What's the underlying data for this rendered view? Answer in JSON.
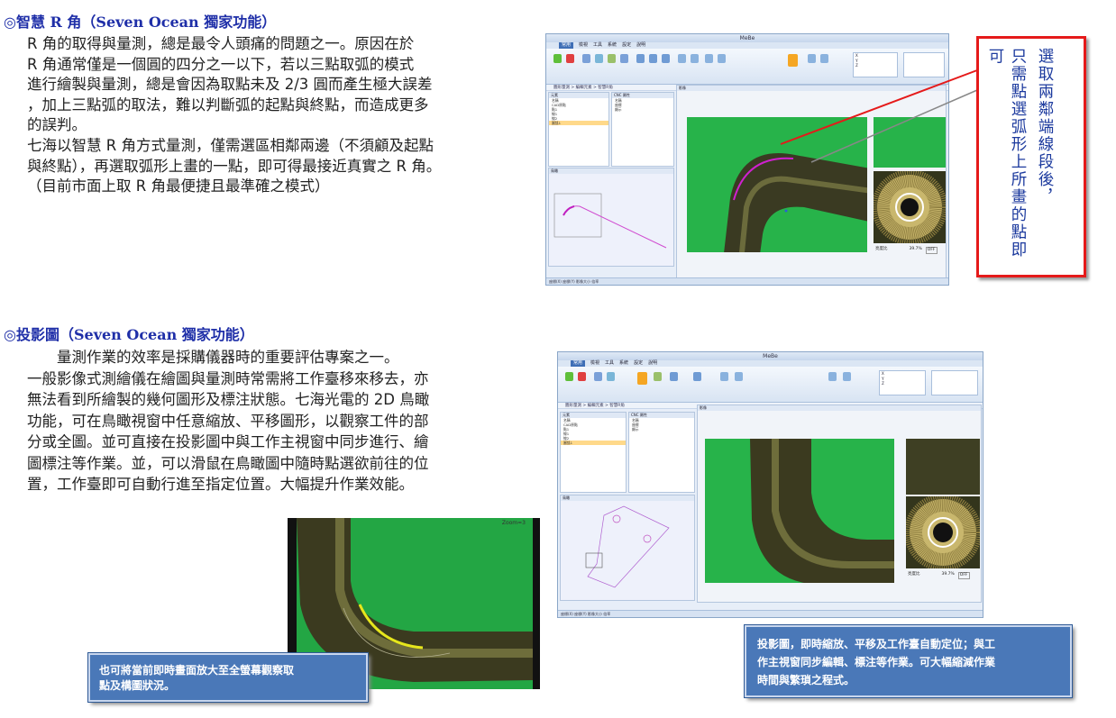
{
  "section1": {
    "heading": "◎智慧 R 角（Seven Ocean 獨家功能）",
    "lines": [
      "R 角的取得與量測，總是最令人頭痛的問題之一。原因在於",
      "R 角通常僅是一個圓的四分之一以下，若以三點取弧的模式",
      "進行繪製與量測，總是會因為取點未及 2/3 圓而產生極大誤差",
      "，加上三點弧的取法，難以判斷弧的起點與終點，而造成更多",
      "的誤判。",
      "七海以智慧 R 角方式量測，僅需選區相鄰兩邊（不須顧及起點",
      "與終點），再選取弧形上畫的一點，即可得最接近真實之 R 角。",
      "（目前市面上取 R 角最便捷且最準確之模式）"
    ],
    "callout_col1": "選取兩鄰端線段後，",
    "callout_col2": "只需點選弧形上所畫的點即可"
  },
  "section2": {
    "heading": "◎投影圖（Seven Ocean 獨家功能）",
    "lines": [
      "　　量測作業的效率是採購儀器時的重要評估專案之一。",
      "一般影像式測繪儀在繪圖與量測時常需將工作臺移來移去，亦",
      "無法看到所繪製的幾何圖形及標注狀態。七海光電的 2D 鳥瞰",
      "功能，可在鳥瞰視窗中任意縮放、平移圖形，以觀察工件的部",
      "分或全圖。並可直接在投影圖中與工作主視窗中同步進行、繪",
      "圖標注等作業。並，可以滑鼠在鳥瞰圖中隨時點選欲前往的位",
      "置，工作臺即可自動行進至指定位置。大幅提升作業效能。"
    ],
    "callout_photo": [
      "也可將當前即時畫面放大至全螢幕觀察取",
      "點及構圖狀況。"
    ],
    "callout_right": [
      "投影圖，即時縮放、平移及工作臺自動定位；與工",
      "作主視窗同步編輯、標注等作業。可大幅縮減作業",
      "時間與繁瑣之程式。"
    ]
  },
  "software": {
    "title": "MeBe",
    "menu": [
      "常用",
      "檢視",
      "工具",
      "系統",
      "設定",
      "說明"
    ],
    "breadcrumb": "圖形量測 > 編輯元素 > 智慧R角",
    "panel_tree": "元素",
    "panel_props": "CNC 屬性",
    "panel_view": "影像",
    "panel_bird": "鳥瞰",
    "coords": [
      "X",
      "Y",
      "Z"
    ],
    "tree_items": [
      "名稱",
      "CAD原點",
      "點1",
      "線1",
      "線2",
      "圓弧1"
    ],
    "prop_items": [
      "名稱",
      "座標",
      "顯示"
    ],
    "status": "座標(X) 座標(Y) 影像大小 倍率",
    "ratio_label": "亮度比",
    "ratio_value": "39.7%",
    "off_label": "OFF",
    "photo_label": "Zoom=3"
  },
  "colors": {
    "heading": "#1f2fa8",
    "callout_red_border": "#e51a1a",
    "callout_red_text": "#1c3a9e",
    "callout_blue_bg": "#4a78b8",
    "camera_green": "#27b34a"
  }
}
